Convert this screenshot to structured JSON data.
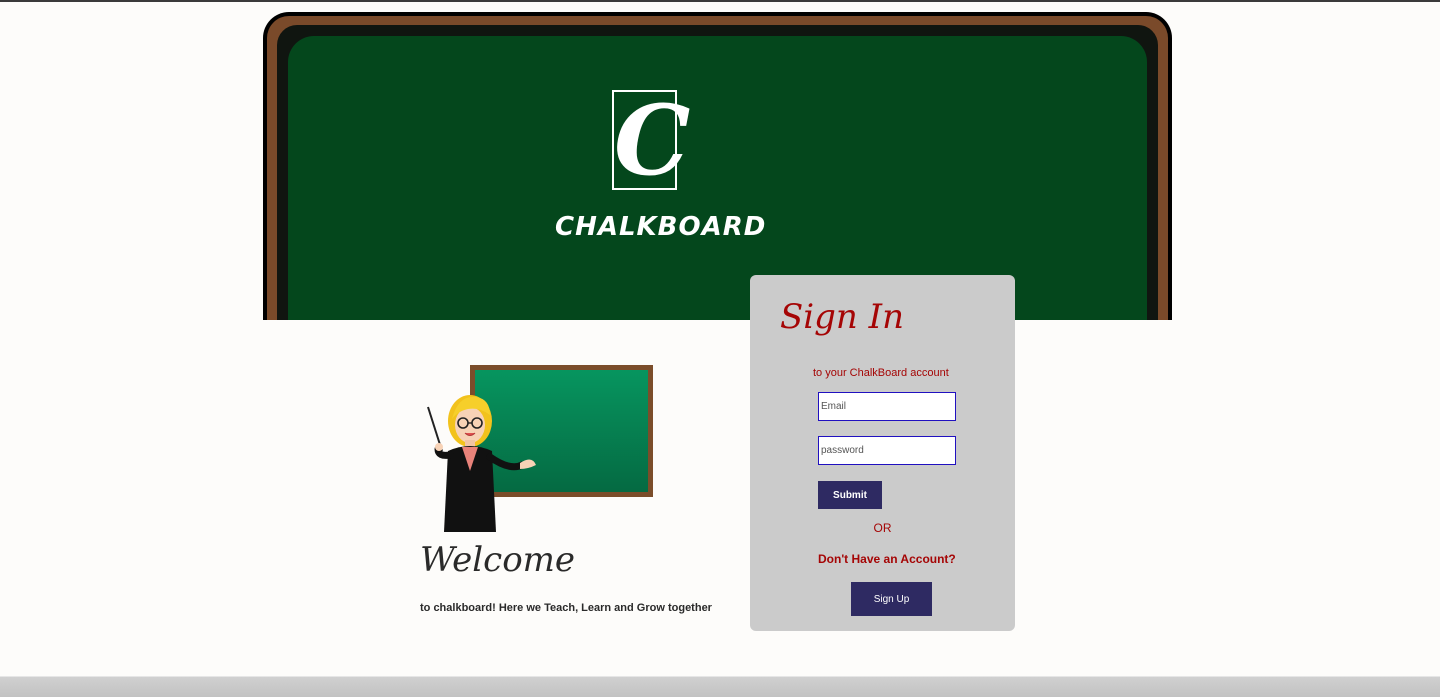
{
  "header": {
    "logo_letter": "C",
    "brand_name": "CHALKBOARD"
  },
  "welcome": {
    "title": "Welcome",
    "subtitle": "to chalkboard! Here we Teach, Learn and Grow together"
  },
  "signin": {
    "title": "Sign In",
    "subtitle": "to your ChalkBoard account",
    "email_placeholder": "Email",
    "password_placeholder": "password",
    "submit_label": "Submit",
    "or_label": "OR",
    "no_account_label": "Don't Have an Account?",
    "signup_label": "Sign Up"
  },
  "colors": {
    "board_green": "#04471c",
    "board_wood": "#7a4a2a",
    "card_bg": "#cbcbcb",
    "accent_red": "#a50505",
    "button_navy": "#2e2a62",
    "input_border": "#2010c0"
  }
}
